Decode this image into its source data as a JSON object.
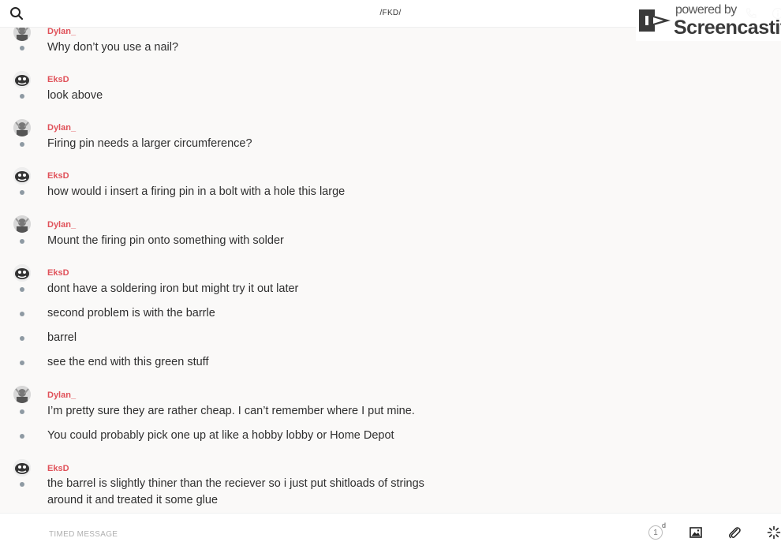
{
  "header": {
    "channel_title": "/FKD/",
    "search_icon": "search-icon",
    "call_icon": "phone-icon",
    "info_icon": "info-icon"
  },
  "watermark": {
    "line1": "powered by",
    "line2": "Screencastify"
  },
  "colors": {
    "author": "#e0525a",
    "bullet": "#8e9aa3",
    "background": "#faf9f8"
  },
  "groups": [
    {
      "author": "Dylan_",
      "avatar": "dylan-avatar",
      "messages": [
        "Why don’t you use a nail?"
      ]
    },
    {
      "author": "EksD",
      "avatar": "eksd-avatar",
      "messages": [
        "look above"
      ]
    },
    {
      "author": "Dylan_",
      "avatar": "dylan-avatar",
      "messages": [
        "Firing pin needs a larger circumference?"
      ]
    },
    {
      "author": "EksD",
      "avatar": "eksd-avatar",
      "messages": [
        "how would i insert a firing pin in a bolt with a hole this large"
      ]
    },
    {
      "author": "Dylan_",
      "avatar": "dylan-avatar",
      "messages": [
        "Mount the firing pin onto something with solder"
      ]
    },
    {
      "author": "EksD",
      "avatar": "eksd-avatar",
      "messages": [
        "dont have a soldering iron but might try it out later",
        "second problem is with the barrle",
        "barrel",
        "see the end with this green stuff"
      ]
    },
    {
      "author": "Dylan_",
      "avatar": "dylan-avatar",
      "messages": [
        "I’m pretty sure they are rather cheap. I can’t remember where I put mine.",
        "You could probably pick one up at like a hobby lobby or Home Depot"
      ]
    },
    {
      "author": "EksD",
      "avatar": "eksd-avatar",
      "messages": [
        "the barrel is slightly thiner than the reciever so i just put shitloads of strings around it and treated it some glue"
      ]
    }
  ],
  "composer": {
    "placeholder": "TIMED MESSAGE",
    "timer_value": "1",
    "timer_unit": "d",
    "image_icon": "image-icon",
    "attach_icon": "paperclip-icon",
    "more_icon": "sparkle-icon"
  }
}
